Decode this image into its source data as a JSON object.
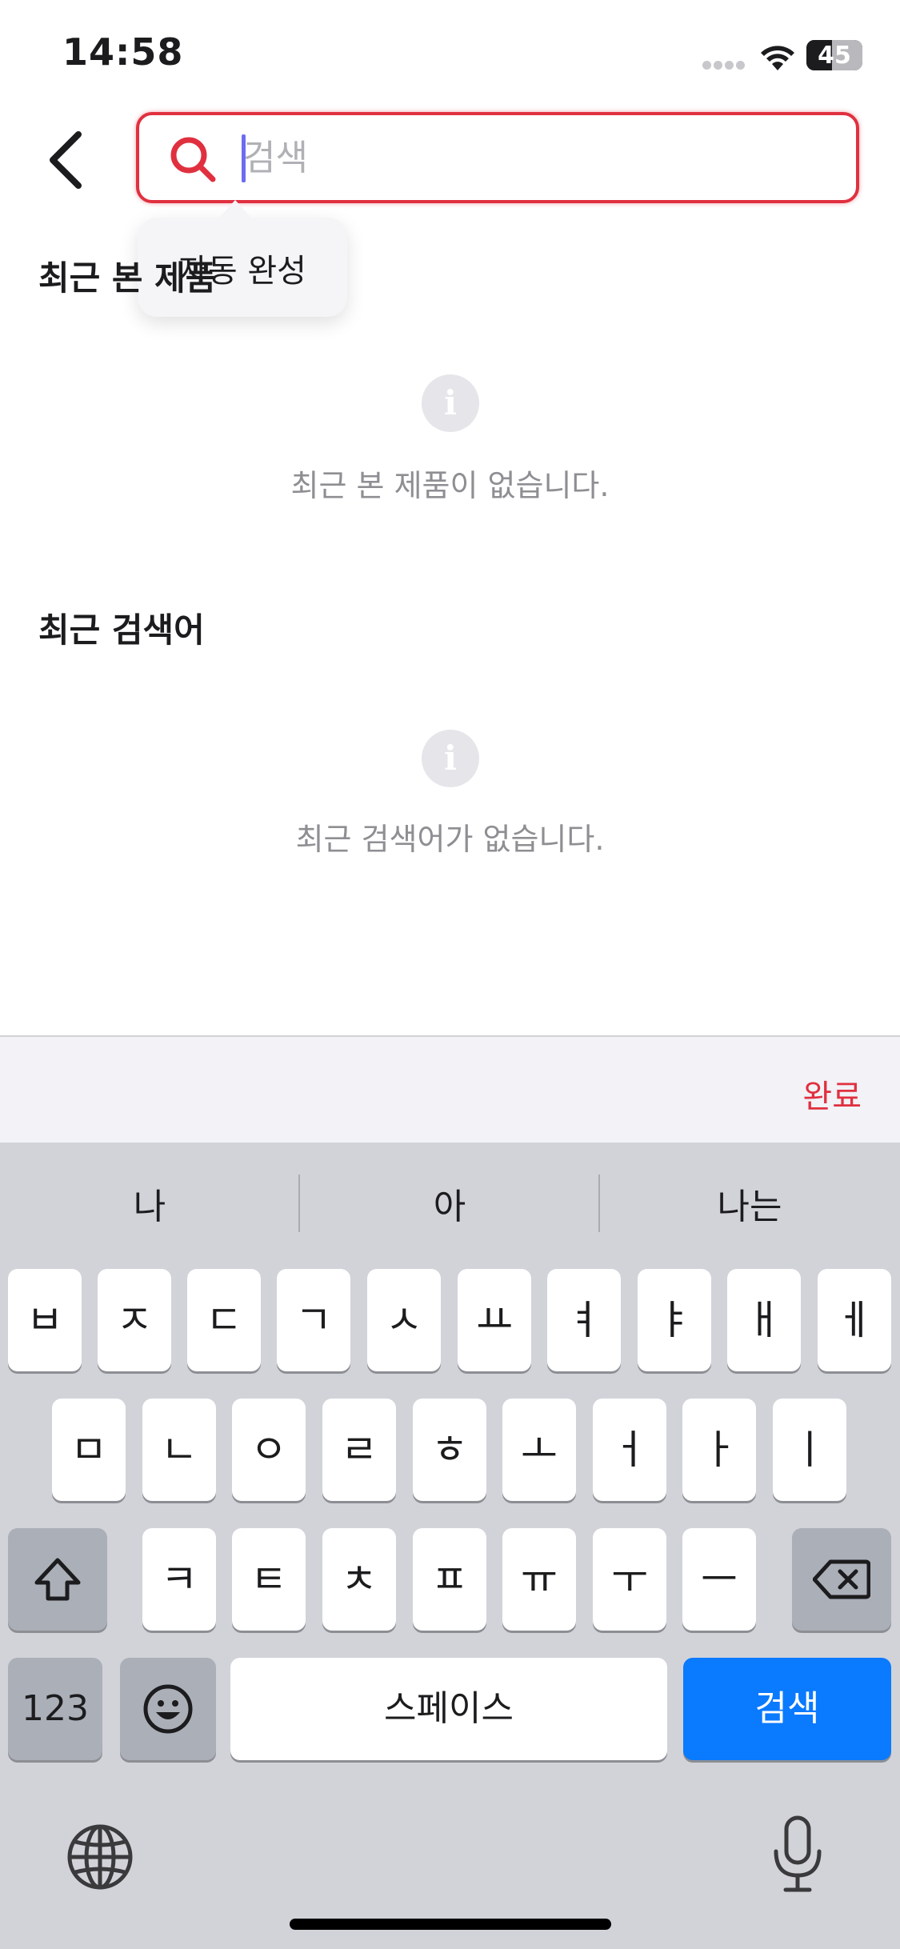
{
  "status_bar": {
    "time": "14:58",
    "battery": "45",
    "battery_level": 0.45
  },
  "search": {
    "placeholder": "검색",
    "value": ""
  },
  "autocomplete": {
    "label": "자동 완성"
  },
  "recent_viewed": {
    "title": "최근 본 제품",
    "empty_text": "최근 본 제품이 없습니다."
  },
  "recent_search": {
    "title": "최근 검색어",
    "empty_text": "최근 검색어가 없습니다."
  },
  "accessory": {
    "done_label": "완료"
  },
  "keyboard": {
    "suggestions": [
      "나",
      "아",
      "나는"
    ],
    "row1": [
      "ㅂ",
      "ㅈ",
      "ㄷ",
      "ㄱ",
      "ㅅ",
      "ㅛ",
      "ㅕ",
      "ㅑ",
      "ㅐ",
      "ㅔ"
    ],
    "row2": [
      "ㅁ",
      "ㄴ",
      "ㅇ",
      "ㄹ",
      "ㅎ",
      "ㅗ",
      "ㅓ",
      "ㅏ",
      "ㅣ"
    ],
    "row3": [
      "ㅋ",
      "ㅌ",
      "ㅊ",
      "ㅍ",
      "ㅠ",
      "ㅜ",
      "ㅡ"
    ],
    "numbers_label": "123",
    "space_label": "스페이스",
    "search_label": "검색",
    "icons": {
      "shift": "shift-icon",
      "delete": "backspace-icon",
      "emoji": "emoji-icon",
      "globe": "globe-icon",
      "mic": "microphone-icon"
    }
  },
  "colors": {
    "accent": "#e0303f",
    "keyboard_blue": "#0a7aff"
  }
}
